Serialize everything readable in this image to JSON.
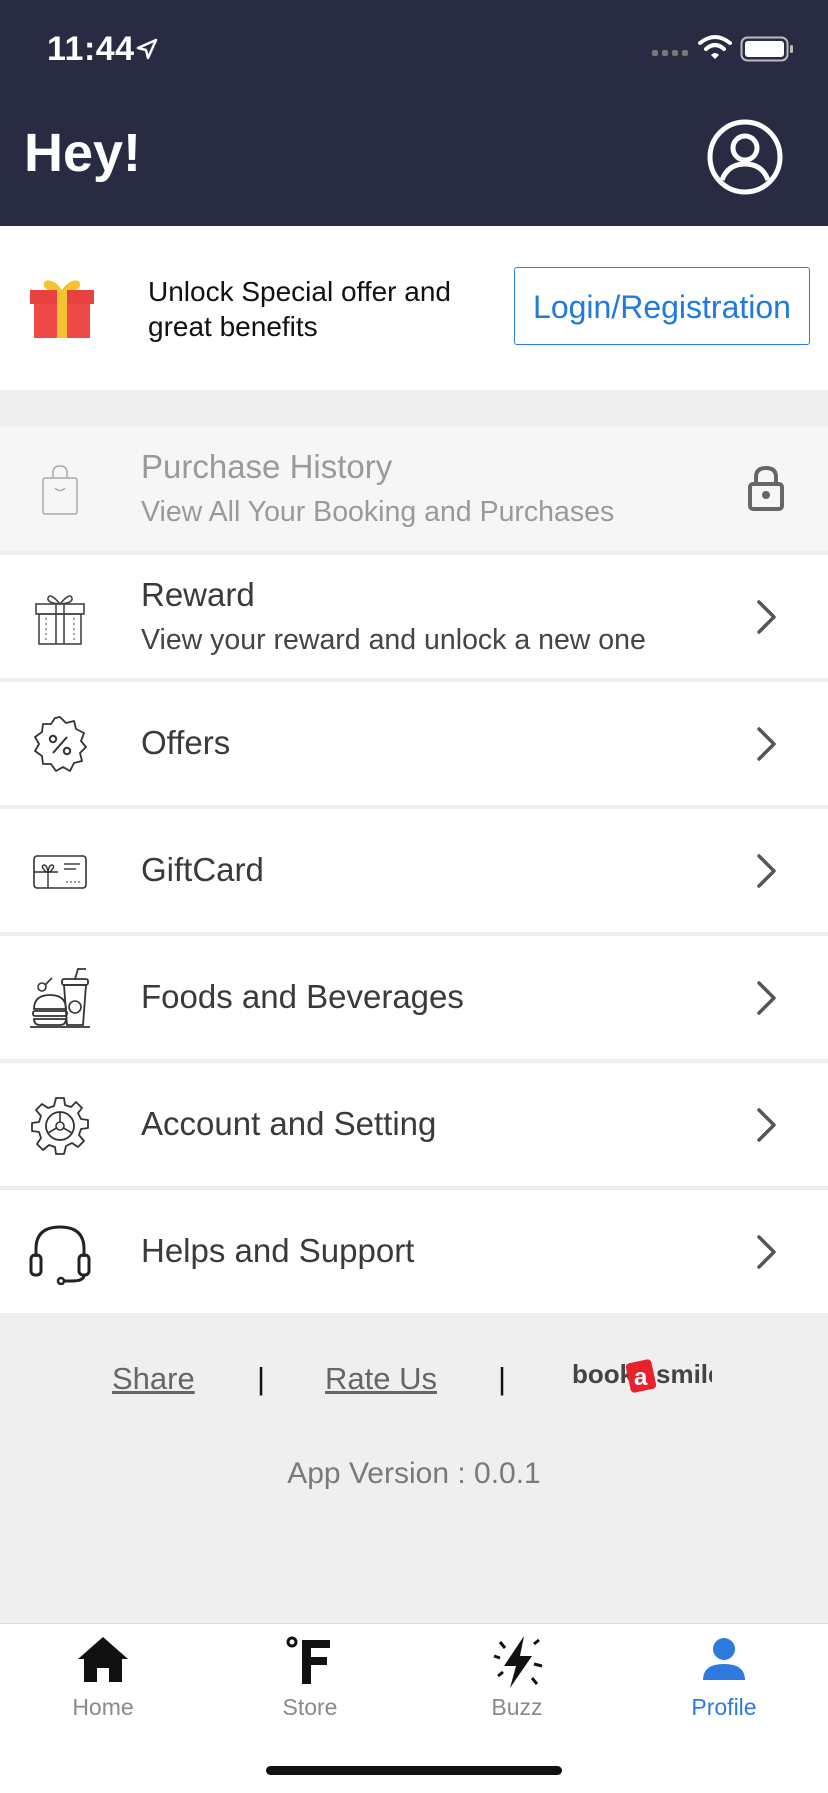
{
  "status_bar": {
    "time": "11:44"
  },
  "header": {
    "greeting": "Hey!"
  },
  "offer": {
    "text": "Unlock Special offer and great benefits",
    "button_label": "Login/Registration"
  },
  "menu": {
    "purchase_history": {
      "title": "Purchase History",
      "subtitle": "View All Your Booking and Purchases",
      "locked": true
    },
    "reward": {
      "title": "Reward",
      "subtitle": "View your reward and unlock a new one"
    },
    "offers": {
      "title": "Offers"
    },
    "giftcard": {
      "title": "GiftCard"
    },
    "foods": {
      "title": "Foods and Beverages"
    },
    "account": {
      "title": "Account and Setting"
    },
    "help": {
      "title": "Helps and Support"
    }
  },
  "footer": {
    "share": "Share",
    "rate": "Rate Us",
    "separator": "|",
    "brand_logo": "bookasmile",
    "version": "App Version : 0.0.1"
  },
  "tabs": {
    "home": "Home",
    "store": "Store",
    "buzz": "Buzz",
    "profile": "Profile",
    "active": "profile"
  },
  "colors": {
    "header_bg": "#292b42",
    "accent": "#2e7be0",
    "background": "#efefef",
    "brand_red": "#e8212d"
  }
}
